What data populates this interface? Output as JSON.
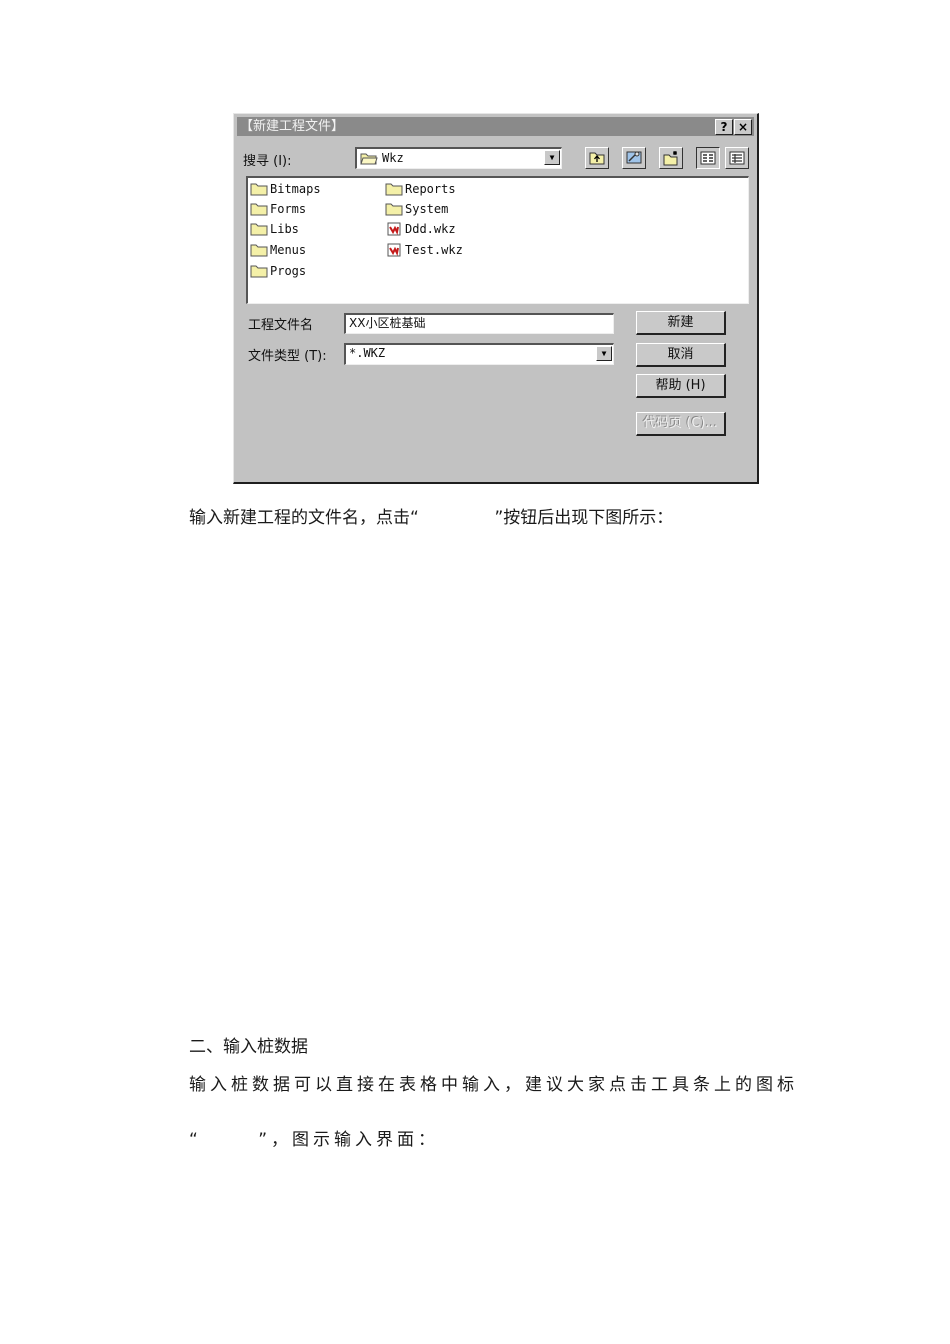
{
  "dialog": {
    "title": "【新建工程文件】",
    "title_buttons": {
      "help": "?",
      "close": "×"
    },
    "look_in_label": "搜寻 (I):",
    "look_in_value": "Wkz",
    "toolbar_icons": [
      "up-folder-icon",
      "desktop-icon",
      "new-folder-icon",
      "list-view-icon",
      "details-view-icon"
    ],
    "files": [
      {
        "name": "Bitmaps",
        "type": "folder"
      },
      {
        "name": "Forms",
        "type": "folder"
      },
      {
        "name": "Libs",
        "type": "folder"
      },
      {
        "name": "Menus",
        "type": "folder"
      },
      {
        "name": "Progs",
        "type": "folder"
      },
      {
        "name": "Reports",
        "type": "folder"
      },
      {
        "name": "System",
        "type": "folder"
      },
      {
        "name": "Ddd.wkz",
        "type": "file"
      },
      {
        "name": "Test.wkz",
        "type": "file"
      }
    ],
    "filename_label": "工程文件名",
    "filename_value": "XX小区桩基础",
    "filetype_label": "文件类型 (T):",
    "filetype_value": "*.WKZ",
    "buttons": {
      "new": "新建",
      "cancel": "取消",
      "help": "帮助 (H)",
      "codepage": "代码页 (C)..."
    }
  },
  "text": {
    "line1": "输入新建工程的文件名，点击“              ”按钮后出现下图所示：",
    "section_heading": "二、输入桩数据",
    "line2": "输入桩数据可以直接在表格中输入，建议大家点击工具条上的图标",
    "line3": "“      ”，图示输入界面："
  }
}
